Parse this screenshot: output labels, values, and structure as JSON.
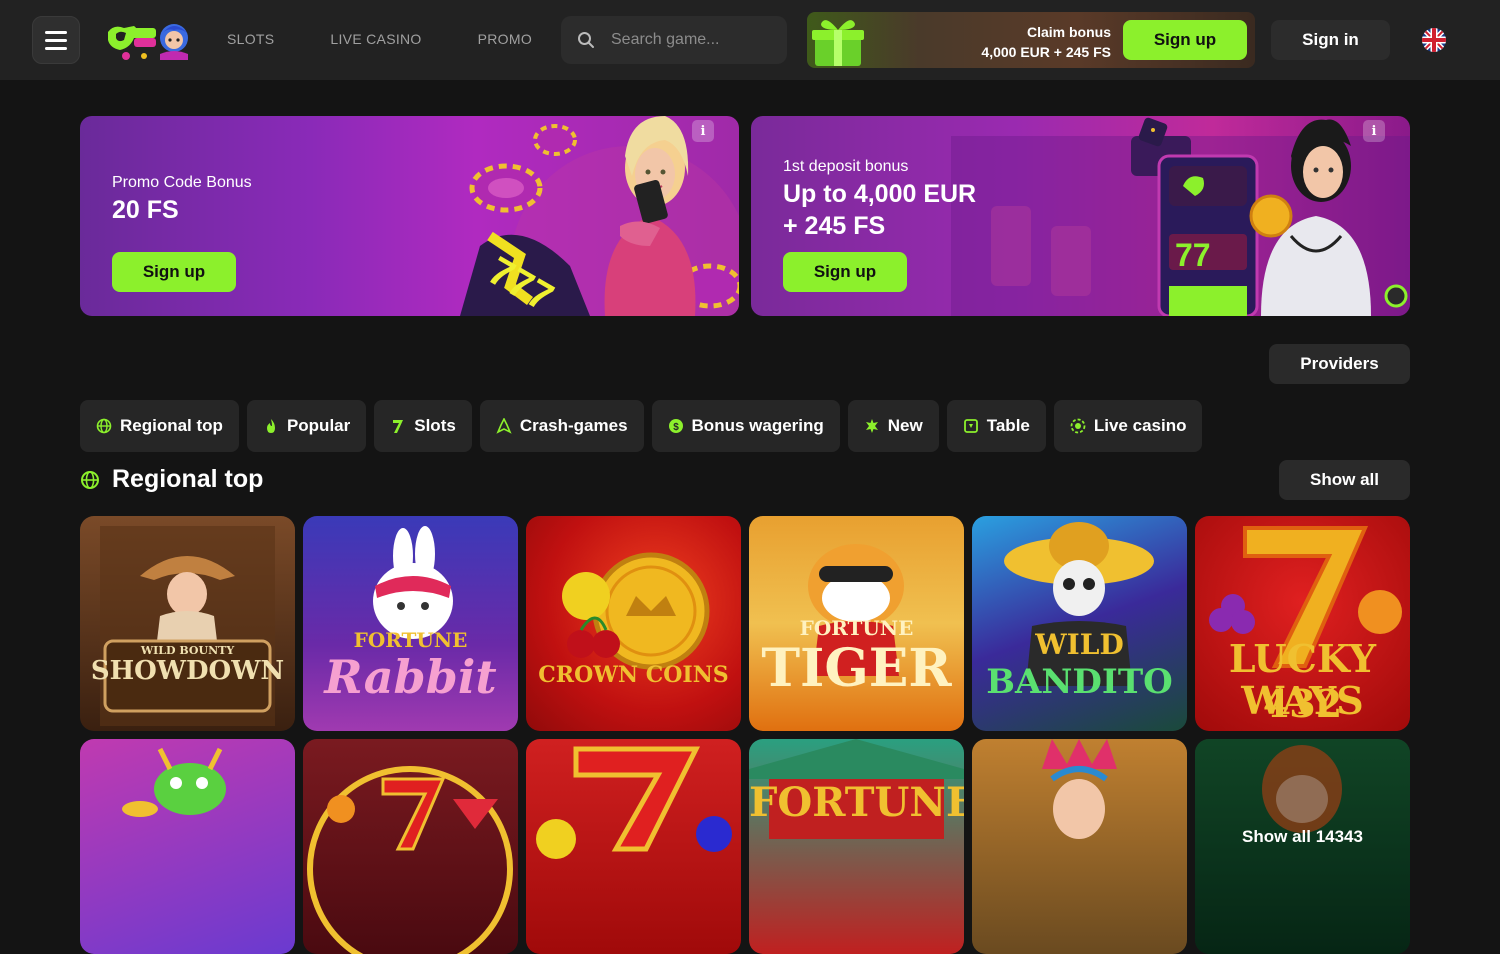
{
  "header": {
    "nav": [
      "SLOTS",
      "LIVE CASINO",
      "PROMO"
    ],
    "search_placeholder": "Search game...",
    "claim": {
      "line1": "Claim bonus",
      "line2": "4,000 EUR + 245 FS",
      "button": "Sign up"
    },
    "signin": "Sign in",
    "language_icon": "uk-flag-icon"
  },
  "banners": [
    {
      "subtitle": "Promo Code Bonus",
      "title": "20 FS",
      "button": "Sign up",
      "info": "i"
    },
    {
      "subtitle": "1st deposit bonus",
      "title_line1": "Up to 4,000 EUR",
      "title_line2": "+ 245 FS",
      "button": "Sign up",
      "info": "i"
    }
  ],
  "providers_label": "Providers",
  "categories": [
    {
      "label": "Regional top",
      "icon": "globe-icon"
    },
    {
      "label": "Popular",
      "icon": "flame-icon"
    },
    {
      "label": "Slots",
      "icon": "seven-icon"
    },
    {
      "label": "Crash-games",
      "icon": "rocket-icon"
    },
    {
      "label": "Bonus wagering",
      "icon": "dollar-coin-icon"
    },
    {
      "label": "New",
      "icon": "sparkle-icon"
    },
    {
      "label": "Table",
      "icon": "cards-icon"
    },
    {
      "label": "Live casino",
      "icon": "chip-icon"
    }
  ],
  "section": {
    "title": "Regional top",
    "show_all": "Show all"
  },
  "games": [
    {
      "name": "WILD BOUNTY SHOWDOWN",
      "name_top": "WILD BOUNTY",
      "name_bottom": "SHOWDOWN"
    },
    {
      "name": "FORTUNE RABBIT",
      "name_top": "FORTUNE",
      "name_bottom": "Rabbit"
    },
    {
      "name": "CROWN COINS",
      "name_top": "",
      "name_bottom": "CROWN COINS"
    },
    {
      "name": "FORTUNE TIGER",
      "name_top": "FORTUNE",
      "name_bottom": "TIGER"
    },
    {
      "name": "WILD BANDITO",
      "name_top": "WILD",
      "name_bottom": "BANDITO"
    },
    {
      "name": "LUCKY 432 WAYS",
      "name_top": "LUCKY 432",
      "name_bottom": "WAYS"
    }
  ],
  "games_row2": [
    {
      "name": ""
    },
    {
      "name": ""
    },
    {
      "name": ""
    },
    {
      "name": "FORTUNE"
    },
    {
      "name": ""
    },
    {
      "name": "Show all 14343"
    }
  ],
  "colors": {
    "accent_green": "#8cf02c",
    "background": "#141414",
    "header": "#222222",
    "chip": "#262626"
  }
}
